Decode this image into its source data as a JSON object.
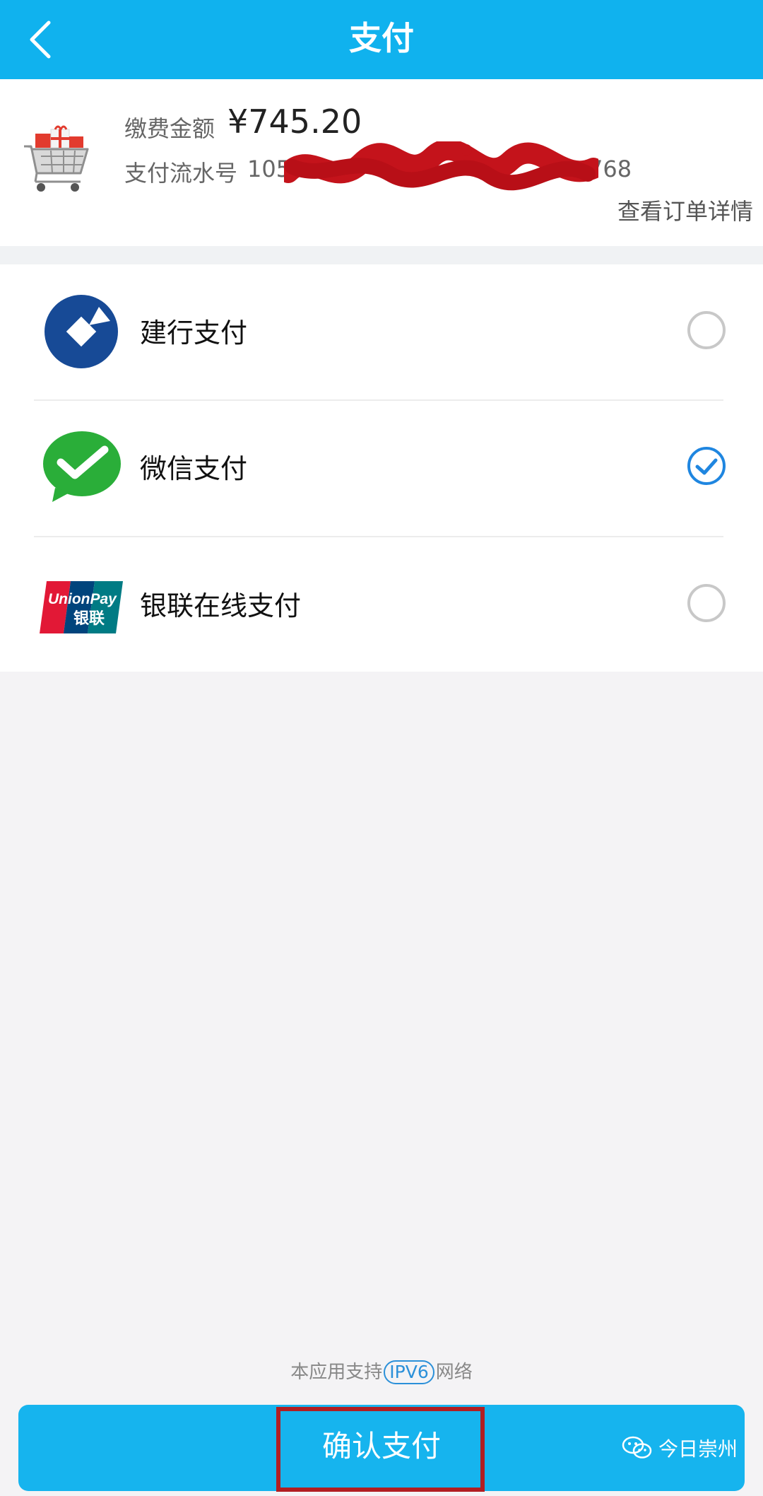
{
  "header": {
    "title": "支付",
    "background_color": "#10b2ee",
    "back_icon": "chevron-left-icon"
  },
  "order": {
    "amount_label": "缴费金额",
    "amount_value": "¥745.20",
    "serial_label": "支付流水号",
    "serial_prefix": "105",
    "serial_suffix": "768",
    "detail_link": "查看订单详情",
    "icon": "shopping-cart-icon"
  },
  "payment_methods": [
    {
      "label": "建行支付",
      "icon": "ccb-bank-logo-icon",
      "selected": false
    },
    {
      "label": "微信支付",
      "icon": "wechat-pay-logo-icon",
      "selected": true
    },
    {
      "label": "银联在线支付",
      "icon": "unionpay-logo-icon",
      "selected": false
    }
  ],
  "unionpay_logo": {
    "latin": "UnionPay",
    "chinese": "银联"
  },
  "footer": {
    "ipv6_prefix": "本应用支持",
    "ipv6_badge": "IPV6",
    "ipv6_suffix": "网络",
    "confirm_label": "确认支付",
    "button_color": "#16b4ee",
    "highlight_color": "#b11e22"
  },
  "watermark": {
    "text": "今日崇州",
    "icon": "wechat-official-account-icon"
  }
}
